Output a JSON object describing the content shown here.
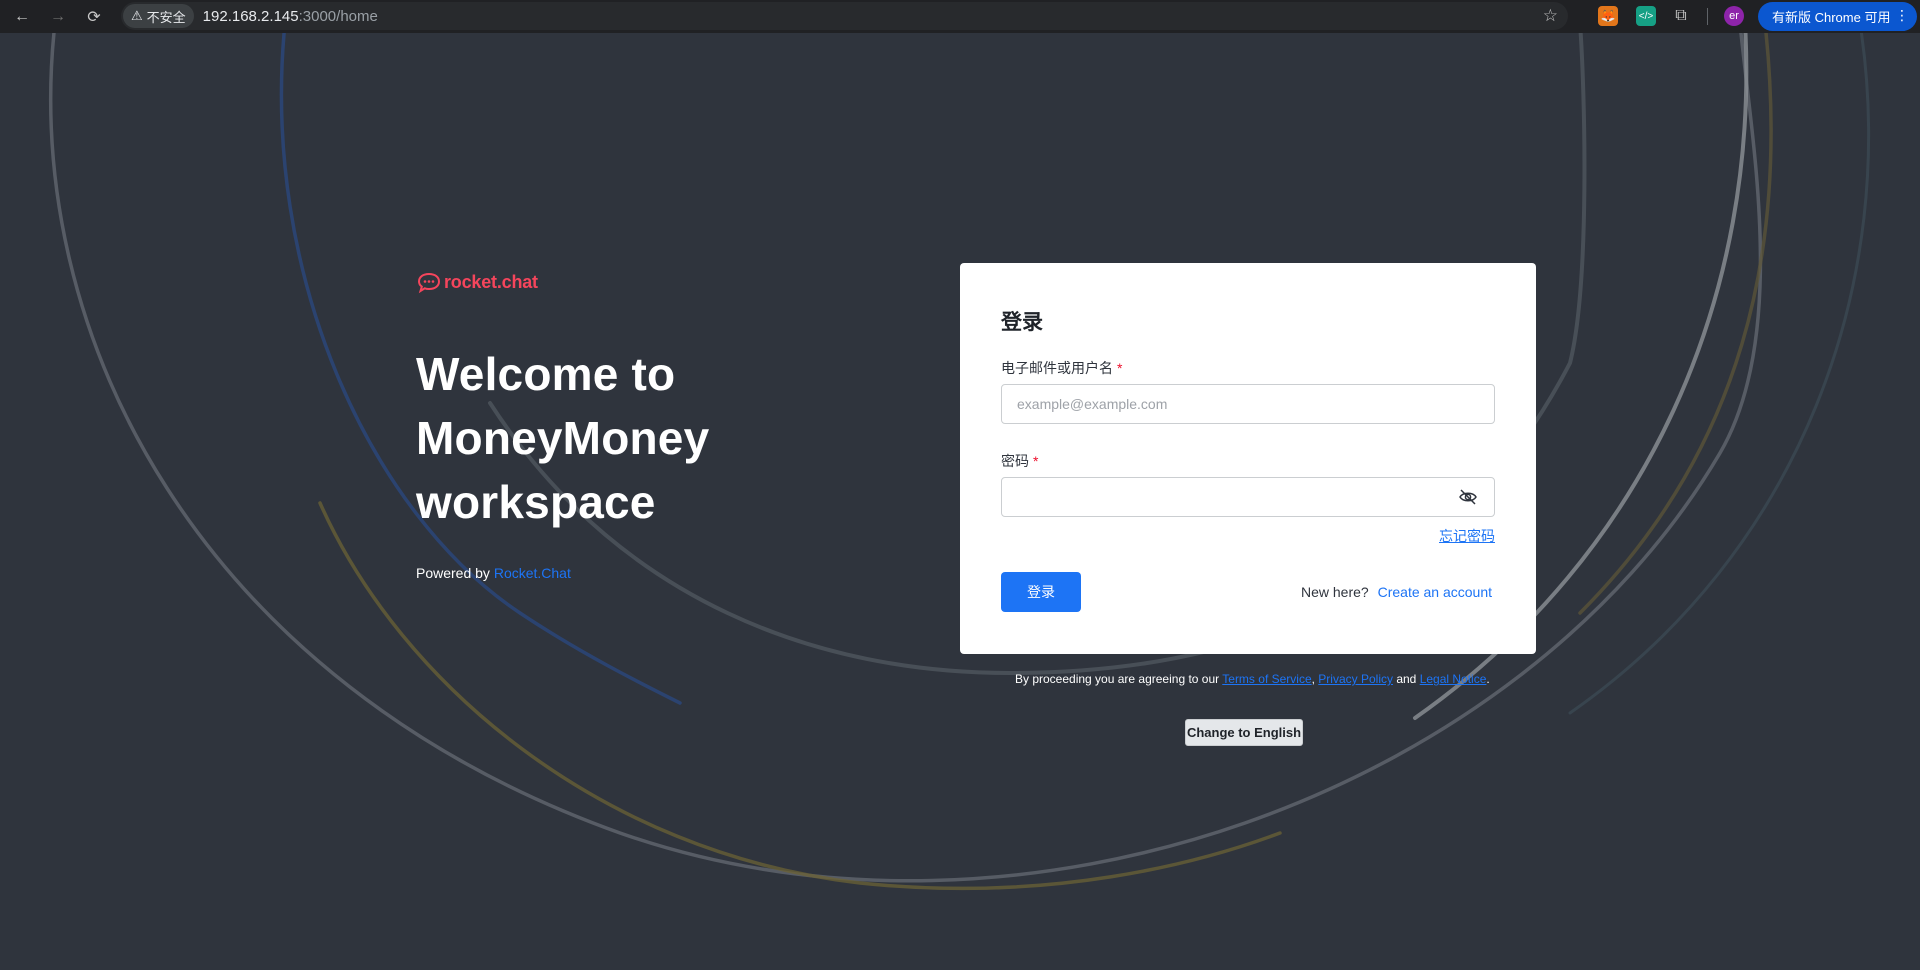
{
  "browser": {
    "back_icon": "←",
    "forward_icon": "→",
    "reload_icon": "⟳",
    "security_label": "不安全",
    "url_host": "192.168.2.145",
    "url_rest": ":3000/home",
    "star_icon": "☆",
    "puzzle_icon": "⧉",
    "profile_initials": "er",
    "update_label": "有新版 Chrome 可用",
    "menu_icon": "⋮"
  },
  "hero": {
    "brand": "rocket.chat",
    "title_line1": "Welcome to",
    "title_line2": "MoneyMoney",
    "title_line3": "workspace",
    "powered_prefix": "Powered by ",
    "powered_link": "Rocket.Chat"
  },
  "login": {
    "title": "登录",
    "email_label": "电子邮件或用户名",
    "email_placeholder": "example@example.com",
    "email_value": "",
    "password_label": "密码",
    "password_value": "",
    "required_mark": "*",
    "forgot_label": "忘记密码",
    "submit_label": "登录",
    "new_here": "New here?",
    "create_account": "Create an account"
  },
  "footer": {
    "terms_prefix": "By proceeding you are agreeing to our ",
    "terms_link": "Terms of Service",
    "comma": ", ",
    "privacy_link": "Privacy Policy",
    "and_text": " and ",
    "legal_link": "Legal Notice",
    "period": ".",
    "language_button": "Change to English"
  },
  "colors": {
    "background": "#2f343d",
    "brand_red": "#f5455c",
    "primary_blue": "#1d74f5",
    "chrome_bg": "#202124"
  }
}
